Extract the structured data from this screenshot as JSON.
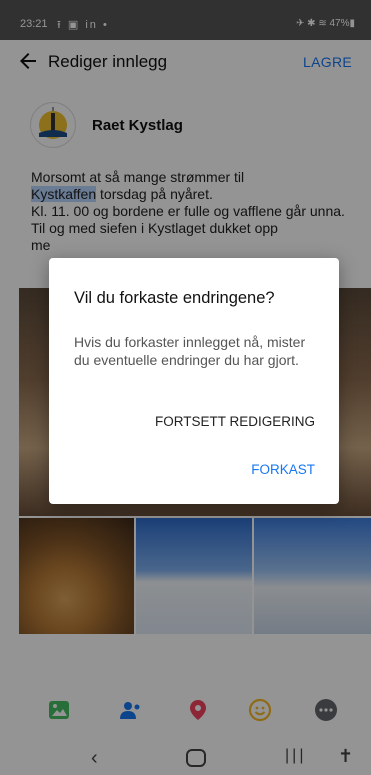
{
  "status_bar": {
    "time": "23:21",
    "left_icons": "⭱ ▣ in •",
    "right": "✈ ✱ ≋ 47%▮"
  },
  "app_bar": {
    "title": "Rediger innlegg",
    "save_label": "LAGRE"
  },
  "post": {
    "author": "Raet Kystlag",
    "text_prefix": "Morsomt at så mange strømmer til",
    "text_link": "Kystkaffen",
    "text_after_link": " torsdag på nyåret.",
    "line3": "Kl. 11. 00 og bordene er fulle og vafflene går unna.",
    "line4": "Til og med siefen i Kystlaget dukket opp",
    "line5": "me"
  },
  "dialog": {
    "title": "Vil du forkaste endringene?",
    "message": "Hvis du forkaster innlegget nå, mister du eventuelle endringer du har gjort.",
    "continue_label": "FORTSETT REDIGERING",
    "discard_label": "FORKAST"
  },
  "toolbar": {
    "icons": [
      "photo-icon",
      "tag-people-icon",
      "location-icon",
      "feeling-icon",
      "more-icon"
    ],
    "colors": {
      "photo": "#45bd62",
      "tag": "#1877f2",
      "location": "#f3425f",
      "feeling": "#f7b928",
      "more": "#65676b"
    }
  },
  "nav_bar": {
    "back": "‹",
    "recent": "|||",
    "accessibility": "✝"
  }
}
